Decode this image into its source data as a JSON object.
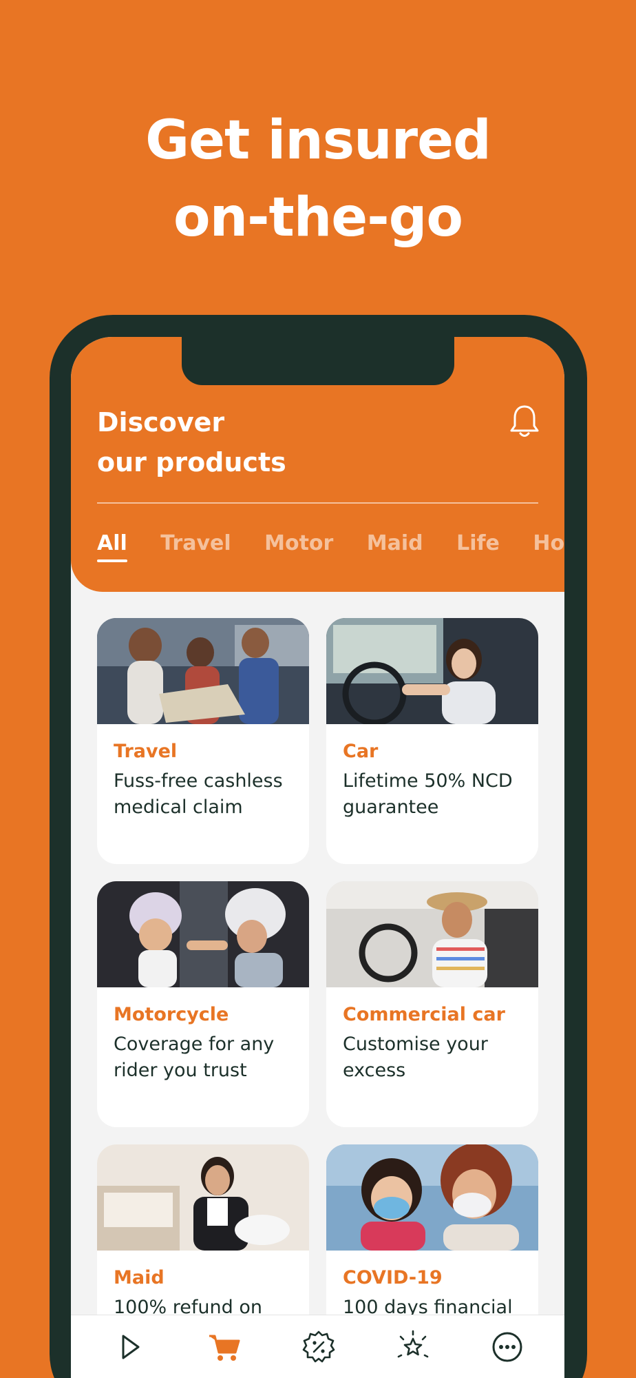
{
  "hero": {
    "line1": "Get insured",
    "line2": "on-the-go"
  },
  "header": {
    "title_line1": "Discover",
    "title_line2": "our products",
    "bell_icon": "bell-icon"
  },
  "tabs": [
    {
      "label": "All",
      "active": true
    },
    {
      "label": "Travel",
      "active": false
    },
    {
      "label": "Motor",
      "active": false
    },
    {
      "label": "Maid",
      "active": false
    },
    {
      "label": "Life",
      "active": false
    },
    {
      "label": "Home",
      "active": false
    }
  ],
  "products": [
    {
      "title": "Travel",
      "desc": "Fuss-free cashless medical claim",
      "image": "friends with map"
    },
    {
      "title": "Car",
      "desc": "Lifetime 50% NCD guarantee",
      "image": "woman driving car"
    },
    {
      "title": "Motorcycle",
      "desc": "Coverage for any rider you trust",
      "image": "rider and child with helmets"
    },
    {
      "title": "Commercial car",
      "desc": "Customise your excess",
      "image": "man driving car"
    },
    {
      "title": "Maid",
      "desc": "100% refund on",
      "image": "maid cleaning"
    },
    {
      "title": "COVID-19",
      "desc": "100 days financial",
      "image": "mother and child with masks"
    }
  ],
  "bottom_nav": [
    {
      "icon": "play-icon",
      "active": false
    },
    {
      "icon": "cart-icon",
      "active": true
    },
    {
      "icon": "discount-badge-icon",
      "active": false
    },
    {
      "icon": "sparkle-star-icon",
      "active": false
    },
    {
      "icon": "more-icon",
      "active": false
    }
  ],
  "colors": {
    "accent": "#E87524",
    "dark": "#1C302A",
    "background": "#F3F3F3"
  }
}
